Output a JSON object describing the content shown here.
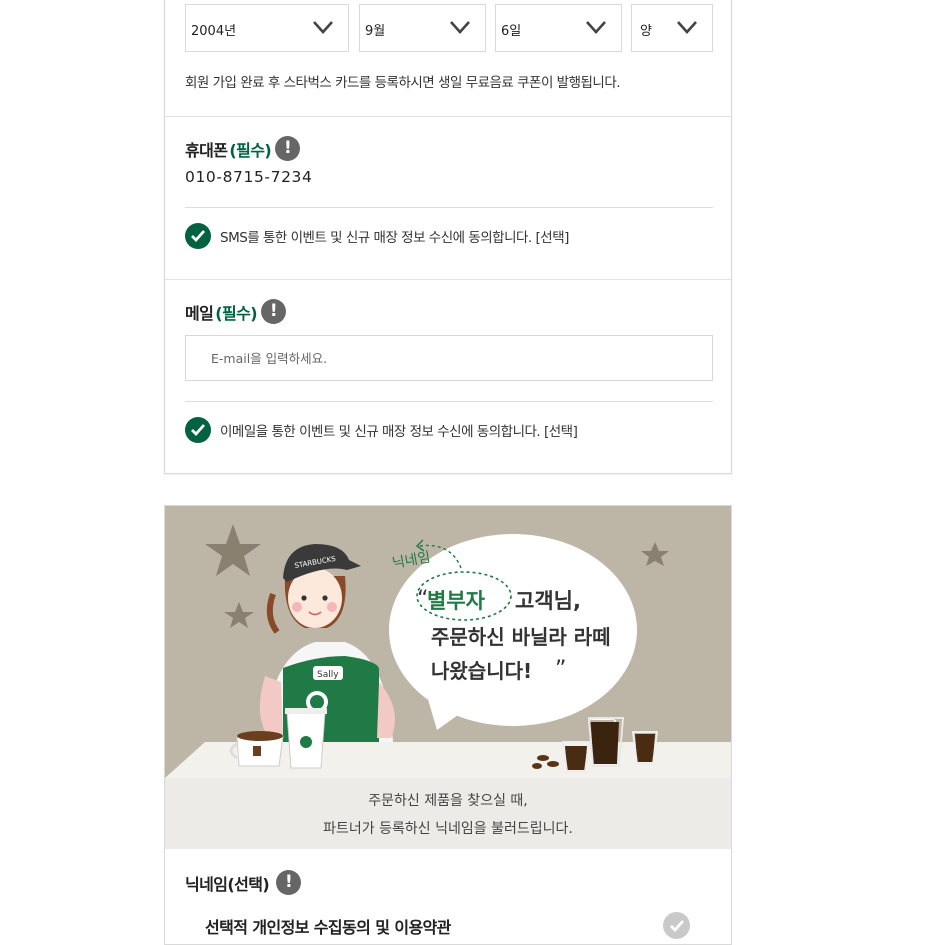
{
  "birthday": {
    "year": "2004년",
    "month": "9월",
    "day": "6일",
    "calendar": "양",
    "hint": "회원 가입 완료 후 스타벅스 카드를 등록하시면 생일 무료음료 쿠폰이 발행됩니다."
  },
  "phone": {
    "label": "휴대폰",
    "required": "(필수)",
    "value": "010-8715-7234",
    "sms_consent": "SMS를 통한 이벤트 및 신규 매장 정보 수신에 동의합니다. [선택]"
  },
  "email": {
    "label": "메일",
    "required": "(필수)",
    "placeholder": "E-mail을 입력하세요.",
    "consent": "이메일을 통한 이벤트 및 신규 매장 정보 수신에 동의합니다. [선택]"
  },
  "banner": {
    "cap_text": "STARBUCKS",
    "name_tag": "Sally",
    "nickname_tag": "닉네임",
    "speech_nickname": "별부자",
    "speech_line1_rest": "고객님,",
    "speech_line2": "주문하신 바닐라 라떼",
    "speech_line3": "나왔습니다!",
    "caption_line1": "주문하신 제품을 찾으실 때,",
    "caption_line2": "파트너가 등록하신 닉네임을 불러드립니다."
  },
  "nickname": {
    "label": "닉네임(선택)",
    "terms_title": "선택적 개인정보 수집동의 및 이용약관"
  },
  "colors": {
    "brand_green": "#006241",
    "banner_bg": "#bdb5a6"
  },
  "icons": {
    "dropdown": "chevron-down-icon",
    "info": "exclamation-icon",
    "consent": "check-icon"
  }
}
